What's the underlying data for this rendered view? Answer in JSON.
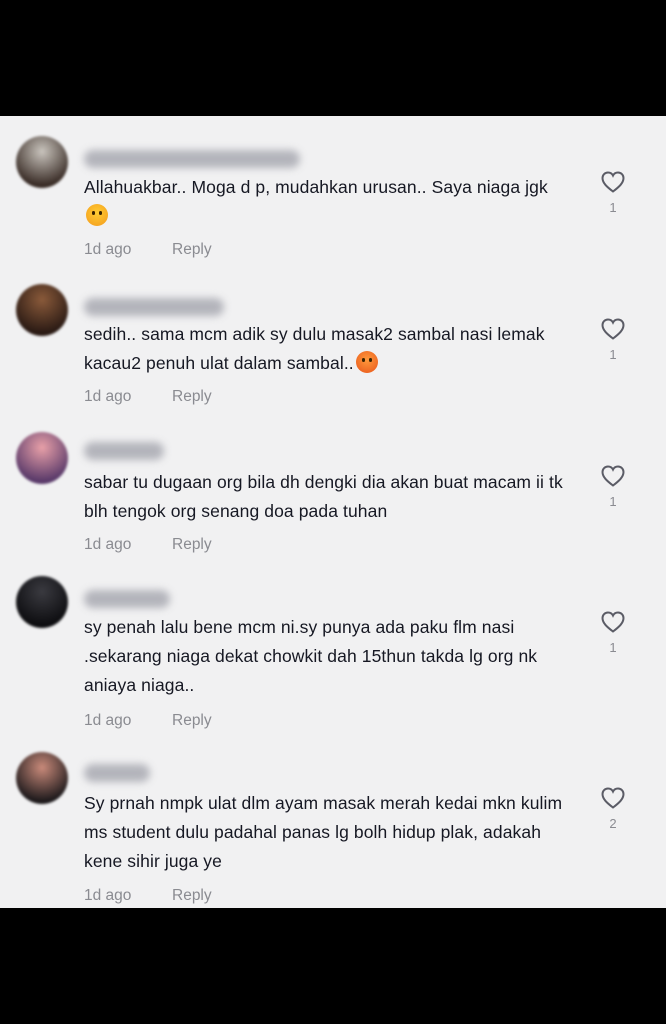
{
  "comments": [
    {
      "text": "Allahuakbar.. Moga d p, mudahkan urusan.. Saya niaga jgk",
      "emoji": "crying-face-emoji",
      "time": "1d ago",
      "reply": "Reply",
      "likes": "1",
      "avatar_colors": [
        "#c9c4bd",
        "#3a2d27"
      ],
      "name_color": "#6b6d78"
    },
    {
      "text": "sedih.. sama mcm adik sy dulu masak2 sambal nasi lemak kacau2 penuh ulat dalam sambal..",
      "emoji": "angry-face-emoji",
      "time": "1d ago",
      "reply": "Reply",
      "likes": "1",
      "avatar_colors": [
        "#8a5a3a",
        "#2a1a14"
      ],
      "name_color": "#6b6d78"
    },
    {
      "text": "sabar tu dugaan org bila dh dengki dia akan buat macam ii tk blh tengok org senang doa pada tuhan",
      "emoji": "",
      "time": "1d ago",
      "reply": "Reply",
      "likes": "1",
      "avatar_colors": [
        "#e8a0a8",
        "#5a3a6a"
      ],
      "name_color": "#6b6d78"
    },
    {
      "text": "sy penah lalu bene mcm ni.sy punya ada paku flm nasi .sekarang niaga dekat chowkit dah 15thun takda lg org nk aniaya niaga..",
      "emoji": "",
      "time": "1d ago",
      "reply": "Reply",
      "likes": "1",
      "avatar_colors": [
        "#3a3a40",
        "#0d0d10"
      ],
      "name_color": "#6b6d78"
    },
    {
      "text": "Sy prnah nmpk ulat dlm ayam masak merah kedai mkn kulim ms student dulu padahal panas lg bolh hidup plak, adakah kene sihir juga ye",
      "emoji": "",
      "time": "1d ago",
      "reply": "Reply",
      "likes": "2",
      "avatar_colors": [
        "#c98a7a",
        "#1e1a1c"
      ],
      "name_color": "#6b6d78"
    }
  ]
}
